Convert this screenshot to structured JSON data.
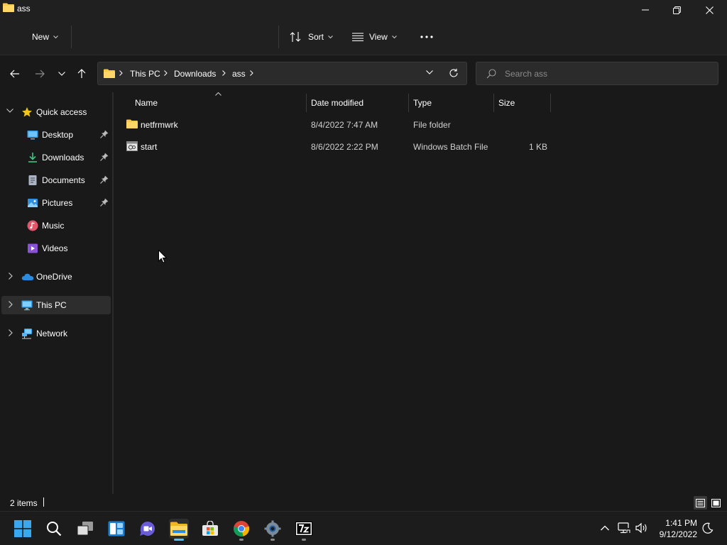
{
  "window": {
    "title": "ass"
  },
  "toolbar": {
    "new_label": "New",
    "sort_label": "Sort",
    "view_label": "View"
  },
  "address": {
    "crumbs": [
      "This PC",
      "Downloads",
      "ass"
    ]
  },
  "search": {
    "placeholder": "Search ass"
  },
  "sidebar": {
    "items": [
      {
        "label": "Quick access",
        "icon": "star-icon"
      },
      {
        "label": "Desktop",
        "icon": "desktop-icon",
        "pinned": true
      },
      {
        "label": "Downloads",
        "icon": "download-icon",
        "pinned": true
      },
      {
        "label": "Documents",
        "icon": "document-icon",
        "pinned": true
      },
      {
        "label": "Pictures",
        "icon": "pictures-icon",
        "pinned": true
      },
      {
        "label": "Music",
        "icon": "music-icon"
      },
      {
        "label": "Videos",
        "icon": "videos-icon"
      },
      {
        "label": "OneDrive",
        "icon": "cloud-icon"
      },
      {
        "label": "This PC",
        "icon": "computer-icon",
        "selected": true
      },
      {
        "label": "Network",
        "icon": "network-icon"
      }
    ]
  },
  "columns": {
    "name": "Name",
    "date": "Date modified",
    "type": "Type",
    "size": "Size"
  },
  "files": [
    {
      "name": "netfrmwrk",
      "date": "8/4/2022 7:47 AM",
      "type": "File folder",
      "size": "",
      "icon": "folder-icon"
    },
    {
      "name": "start",
      "date": "8/6/2022 2:22 PM",
      "type": "Windows Batch File",
      "size": "1 KB",
      "icon": "batch-file-icon"
    }
  ],
  "status": {
    "item_count": "2 items"
  },
  "clock": {
    "time": "1:41 PM",
    "date": "9/12/2022"
  },
  "colors": {
    "accent": "#4cc2ff",
    "folder": "#f8c94a",
    "background": "#191919"
  }
}
